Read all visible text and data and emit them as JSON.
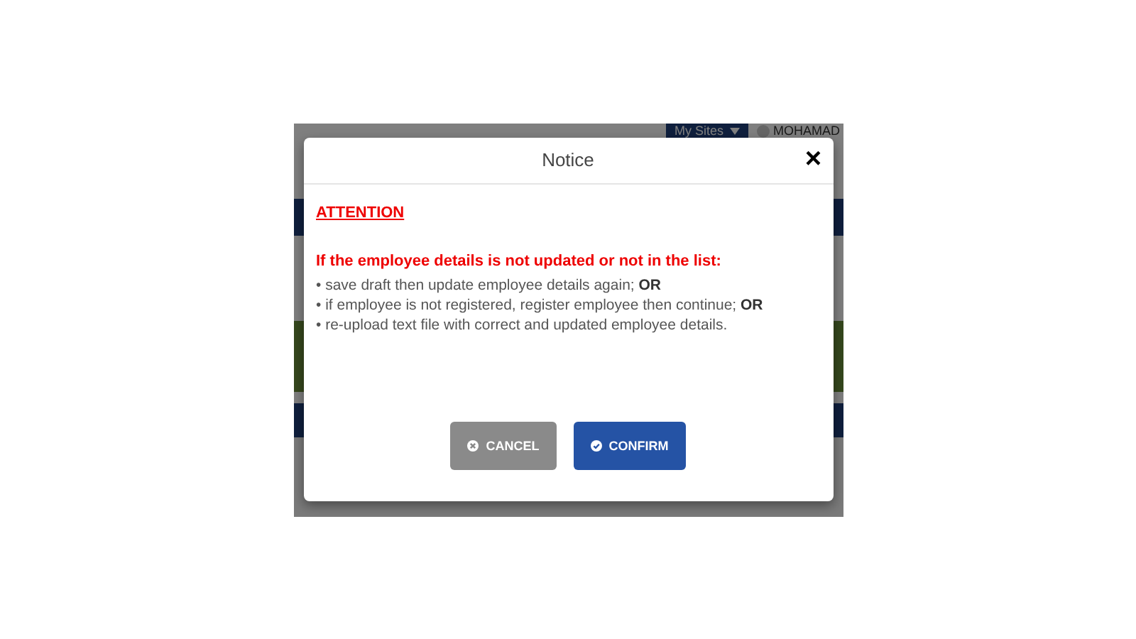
{
  "page": {
    "sites_menu": "My Sites",
    "user_name": "MOHAMAD"
  },
  "dialog": {
    "title": "Notice",
    "close": "×",
    "attention": "ATTENTION",
    "heading": "If the employee details is not updated or not in the list:",
    "lines": [
      "• save draft then update employee details again; **OR**",
      "• if employee is not registered, register employee then continue; **OR**",
      "• re-upload text file with correct and updated employee details."
    ],
    "buttons": [
      {
        "label": "CANCEL",
        "kind": "cancel"
      },
      {
        "label": "CONFIRM",
        "kind": "confirm"
      }
    ]
  }
}
